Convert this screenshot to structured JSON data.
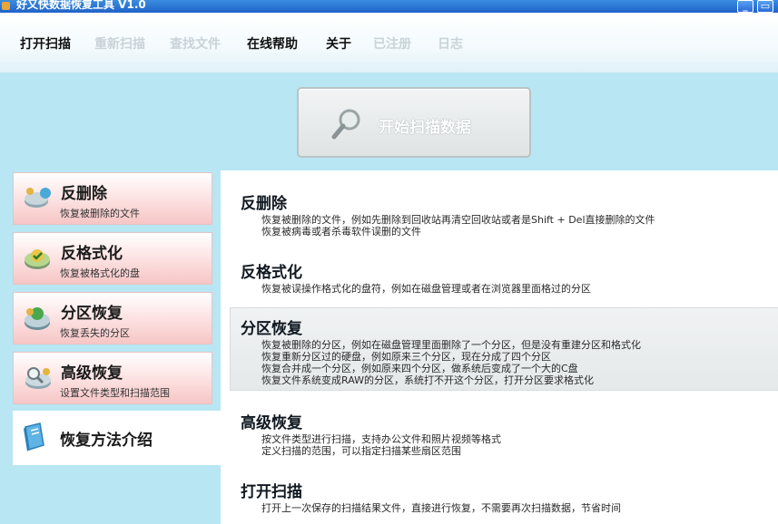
{
  "window": {
    "title": "好又快数据恢复工具 V1.0",
    "minimize_icon": "minimize-icon",
    "maximize_icon": "maximize-icon"
  },
  "menu": {
    "items": [
      {
        "label": "打开扫描",
        "enabled": true
      },
      {
        "label": "重新扫描",
        "enabled": false
      },
      {
        "label": "查找文件",
        "enabled": false
      },
      {
        "label": "在线帮助",
        "enabled": true
      },
      {
        "label": "关于",
        "enabled": true
      },
      {
        "label": "已注册",
        "enabled": false
      },
      {
        "label": "日志",
        "enabled": false
      }
    ]
  },
  "scan_button": {
    "label": "开始扫描数据",
    "icon": "magnifier-icon"
  },
  "sidebar": {
    "items": [
      {
        "title": "反删除",
        "subtitle": "恢复被删除的文件",
        "icon": "recycle-disk-icon"
      },
      {
        "title": "反格式化",
        "subtitle": "恢复被格式化的盘",
        "icon": "format-disk-icon"
      },
      {
        "title": "分区恢复",
        "subtitle": "恢复丢失的分区",
        "icon": "partition-disk-icon"
      },
      {
        "title": "高级恢复",
        "subtitle": "设置文件类型和扫描范围",
        "icon": "advanced-search-icon"
      }
    ],
    "active": {
      "title": "恢复方法介绍",
      "icon": "method-book-icon"
    }
  },
  "intro": {
    "sections": [
      {
        "title": "反删除",
        "lines": [
          "恢复被删除的文件，例如先删除到回收站再清空回收站或者是Shift + Del直接删除的文件",
          "恢复被病毒或者杀毒软件误删的文件"
        ]
      },
      {
        "title": "反格式化",
        "lines": [
          "恢复被误操作格式化的盘符，例如在磁盘管理或者在浏览器里面格过的分区"
        ]
      },
      {
        "title": "分区恢复",
        "lines": [
          "恢复被删除的分区，例如在磁盘管理里面删除了一个分区，但是没有重建分区和格式化",
          "恢复重新分区过的硬盘，例如原来三个分区，现在分成了四个分区",
          "恢复合并成一个分区，例如原来四个分区，做系统后变成了一个大的C盘",
          "恢复文件系统变成RAW的分区，系统打不开这个分区，打开分区要求格式化"
        ]
      },
      {
        "title": "高级恢复",
        "lines": [
          "按文件类型进行扫描，支持办公文件和照片视频等格式",
          "定义扫描的范围，可以指定扫描某些扇区范围"
        ]
      },
      {
        "title": "打开扫描",
        "lines": [
          "打开上一次保存的扫描结果文件，直接进行恢复，不需要再次扫描数据，节省时间"
        ]
      }
    ]
  },
  "colors": {
    "background": "#b8e6f3",
    "card_pink": "#f7c6c6",
    "titlebar_blue": "#1f62c8"
  }
}
